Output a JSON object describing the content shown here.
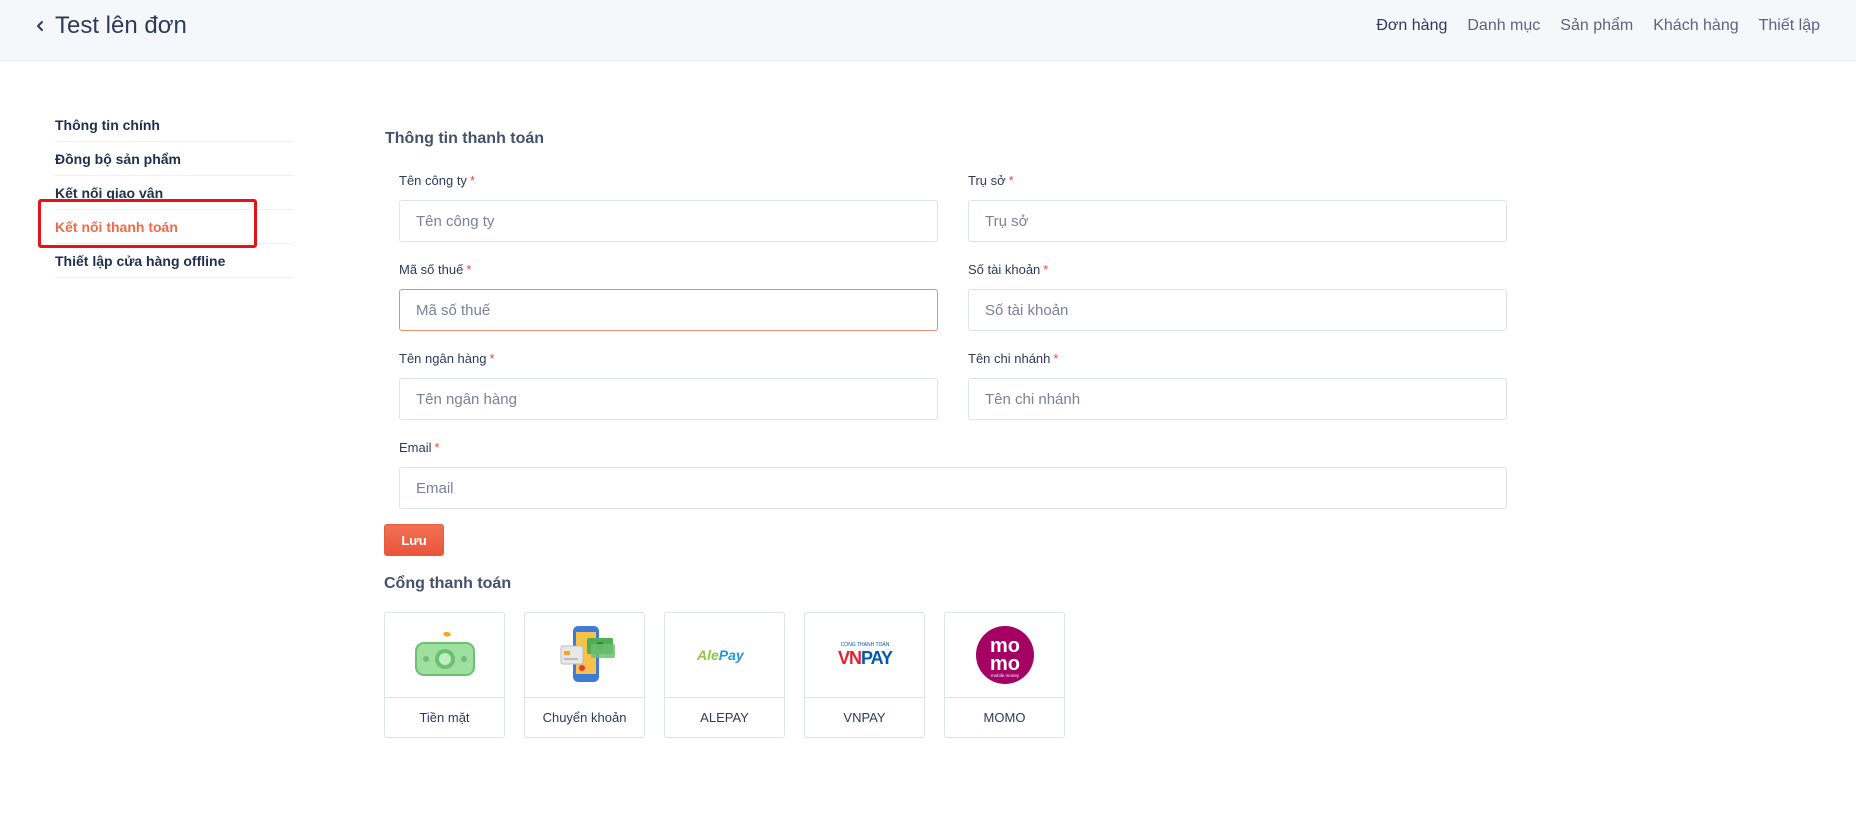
{
  "header": {
    "title": "Test lên đơn",
    "nav": [
      "Đơn hàng",
      "Danh mục",
      "Sản phẩm",
      "Khách hàng",
      "Thiết lập"
    ]
  },
  "sidebar": {
    "items": [
      "Thông tin chính",
      "Đồng bộ sản phẩm",
      "Kết nối giao vận",
      "Kết nối thanh toán",
      "Thiết lập cửa hàng offline"
    ],
    "active_index": 3
  },
  "payment_info": {
    "title": "Thông tin thanh toán",
    "required_mark": "*",
    "fields": {
      "company_name": {
        "label": "Tên công ty",
        "placeholder": "Tên công ty",
        "value": ""
      },
      "headquarters": {
        "label": "Trụ sở",
        "placeholder": "Trụ sở",
        "value": ""
      },
      "tax_code": {
        "label": "Mã số thuế",
        "placeholder": "Mã số thuế",
        "value": ""
      },
      "account_number": {
        "label": "Số tài khoản",
        "placeholder": "Số tài khoản",
        "value": ""
      },
      "bank_name": {
        "label": "Tên ngân hàng",
        "placeholder": "Tên ngân hàng",
        "value": ""
      },
      "branch_name": {
        "label": "Tên chi nhánh",
        "placeholder": "Tên chi nhánh",
        "value": ""
      },
      "email": {
        "label": "Email",
        "placeholder": "Email",
        "value": ""
      }
    },
    "save_label": "Lưu"
  },
  "gateways": {
    "title": "Cổng thanh toán",
    "items": [
      {
        "label": "Tiền mặt",
        "icon": "cash-icon"
      },
      {
        "label": "Chuyển khoản",
        "icon": "bank-transfer-icon"
      },
      {
        "label": "ALEPAY",
        "icon": "alepay-logo",
        "logo_text": "AlePay"
      },
      {
        "label": "VNPAY",
        "icon": "vnpay-logo",
        "logo_caption": "CỔNG THANH TOÁN",
        "logo_text": "VNPAY"
      },
      {
        "label": "MOMO",
        "icon": "momo-logo",
        "logo_line1": "mo",
        "logo_line2": "mo",
        "logo_caption": "mobile money"
      }
    ]
  },
  "colors": {
    "accent": "#ef6a4a",
    "highlight_box": "#e3131b",
    "header_bg": "#f5f7fb",
    "momo": "#a50064",
    "vnpay_red": "#e4202d",
    "vnpay_blue": "#005baa",
    "alepay_green": "#8dc63f",
    "alepay_blue": "#1e9ad6"
  }
}
